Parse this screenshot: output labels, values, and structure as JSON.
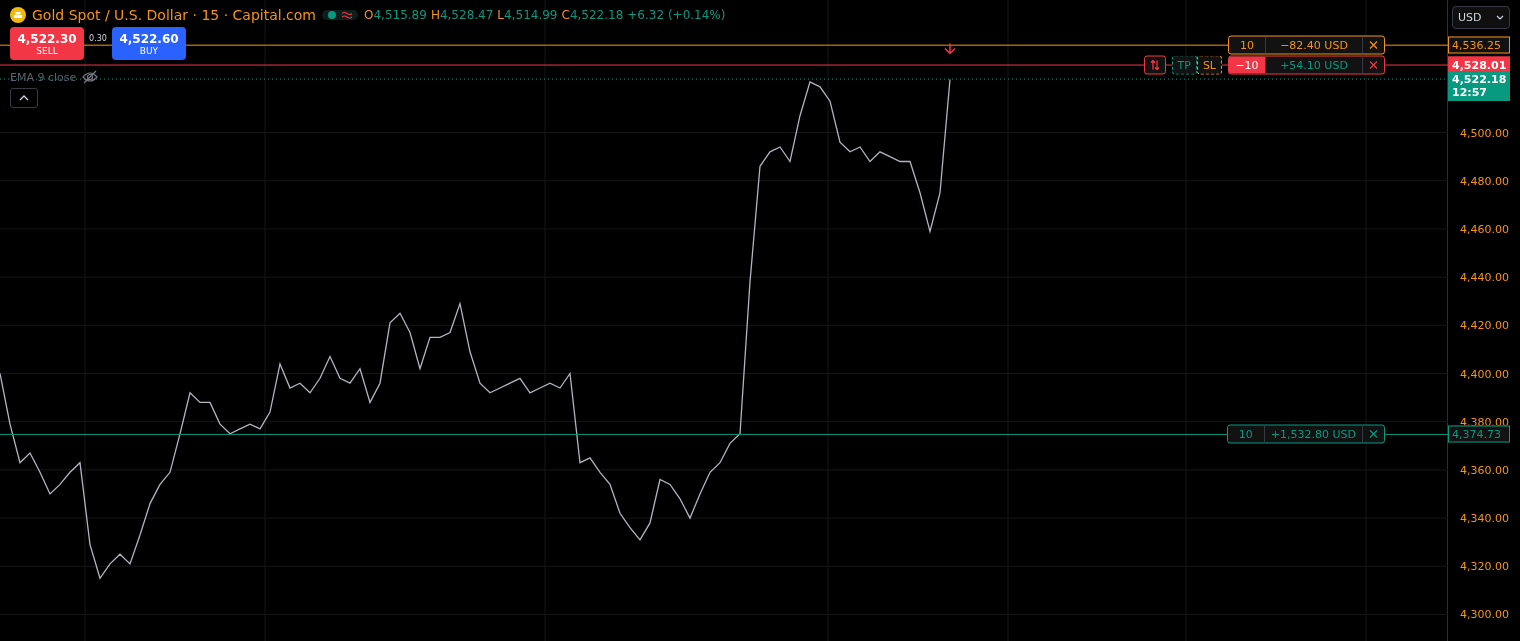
{
  "legend": {
    "title": "Gold Spot / U.S. Dollar · 15 · Capital.com",
    "ohlc": [
      {
        "letter": "O",
        "value": "4,515.89"
      },
      {
        "letter": "H",
        "value": "4,528.47"
      },
      {
        "letter": "L",
        "value": "4,514.99"
      },
      {
        "letter": "C",
        "value": "4,522.18"
      }
    ],
    "change": "+6.32 (+0.14%)"
  },
  "trade": {
    "sell_price": "4,522.30",
    "sell_label": "SELL",
    "spread": "0.30",
    "buy_price": "4,522.60",
    "buy_label": "BUY"
  },
  "indicator": {
    "name": "EMA 9 close",
    "hidden": true
  },
  "legend_expanded": true,
  "currency": "USD",
  "orders": [
    {
      "kind": "order",
      "color": "#f7931a",
      "qty": "10",
      "pnl": "−82.40 USD"
    },
    {
      "kind": "position",
      "color": "#f23645",
      "qty": "−10",
      "pnl": "+54.10 USD",
      "tp": "TP",
      "sl": "SL"
    },
    {
      "kind": "order",
      "color": "#089981",
      "qty": "10",
      "pnl": "+1,532.80 USD"
    }
  ],
  "last_price": {
    "countdown": "12:57"
  },
  "chart_data": {
    "type": "line",
    "grid": true,
    "ref_lines": [
      {
        "axis": "y",
        "value": 4536.25,
        "label": "4,536.25",
        "color": "#f7931a"
      },
      {
        "axis": "y",
        "value": 4528.01,
        "label": "4,528.01",
        "color": "#f23645"
      },
      {
        "axis": "y",
        "value": 4374.73,
        "label": "4,374.73",
        "color": "#089981"
      },
      {
        "axis": "y",
        "value": 4522.18,
        "label": "4,522.18",
        "color": "#089981"
      }
    ],
    "ylim": [
      4289,
      4555
    ],
    "yticks": [
      {
        "value": 4300,
        "label": "4,300.00"
      },
      {
        "value": 4320,
        "label": "4,320.00"
      },
      {
        "value": 4340,
        "label": "4,340.00"
      },
      {
        "value": 4360,
        "label": "4,360.00"
      },
      {
        "value": 4380,
        "label": "4,380.00"
      },
      {
        "value": 4400,
        "label": "4,400.00"
      },
      {
        "value": 4420,
        "label": "4,420.00"
      },
      {
        "value": 4440,
        "label": "4,440.00"
      },
      {
        "value": 4460,
        "label": "4,460.00"
      },
      {
        "value": 4480,
        "label": "4,480.00"
      },
      {
        "value": 4500,
        "label": "4,500.00"
      }
    ],
    "series": [
      {
        "color": "#b2b5be",
        "values": [
          4400,
          4379,
          4363,
          4367,
          4359,
          4350,
          4354,
          4359,
          4363,
          4329,
          4315,
          4321,
          4325,
          4321,
          4333,
          4346,
          4354,
          4359,
          4375,
          4392,
          4388,
          4388,
          4379,
          4375,
          4377,
          4379,
          4377,
          4384,
          4404,
          4394,
          4396,
          4392,
          4398,
          4407,
          4398,
          4396,
          4402,
          4388,
          4396,
          4421,
          4425,
          4417,
          4402,
          4415,
          4415,
          4417,
          4429,
          4409,
          4396,
          4392,
          4394,
          4396,
          4398,
          4392,
          4394,
          4396,
          4394,
          4400,
          4363,
          4365,
          4359,
          4354,
          4342,
          4336,
          4331,
          4338,
          4356,
          4354,
          4348,
          4340,
          4350,
          4359,
          4363,
          4371,
          4375,
          4438,
          4486,
          4492,
          4494,
          4488,
          4507,
          4521,
          4519,
          4513,
          4496,
          4492,
          4494,
          4488,
          4492,
          4490,
          4488,
          4488,
          4475,
          4459,
          4475,
          4522
        ]
      }
    ]
  }
}
